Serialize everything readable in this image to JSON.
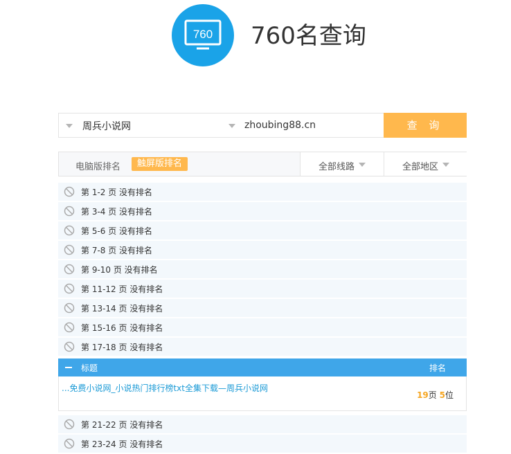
{
  "header": {
    "logo_text": "760",
    "title": "760名查询"
  },
  "search": {
    "site_select": "周兵小说网",
    "domain_value": "zhoubing88.cn",
    "query_button": "查 询"
  },
  "filters": {
    "tab_pc": "电脑版排名",
    "tab_touch": "触屏版排名",
    "line_select": "全部线路",
    "region_select": "全部地区"
  },
  "rows_before": [
    "第 1-2 页 没有排名",
    "第 3-4 页 没有排名",
    "第 5-6 页 没有排名",
    "第 7-8 页 没有排名",
    "第 9-10 页 没有排名",
    "第 11-12 页 没有排名",
    "第 13-14 页 没有排名",
    "第 15-16 页 没有排名",
    "第 17-18 页 没有排名"
  ],
  "result": {
    "header_title": "标题",
    "header_rank": "排名",
    "link_text": "...免费小说网_小说热门排行榜txt全集下载—周兵小说网",
    "page_num": "19",
    "page_unit": "页",
    "pos_num": "5",
    "pos_unit": "位"
  },
  "rows_after": [
    "第 21-22 页 没有排名",
    "第 23-24 页 没有排名"
  ],
  "colors": {
    "accent_orange": "#ffb84d",
    "accent_blue": "#3fa6e9",
    "logo_blue": "#1aa3e8"
  }
}
